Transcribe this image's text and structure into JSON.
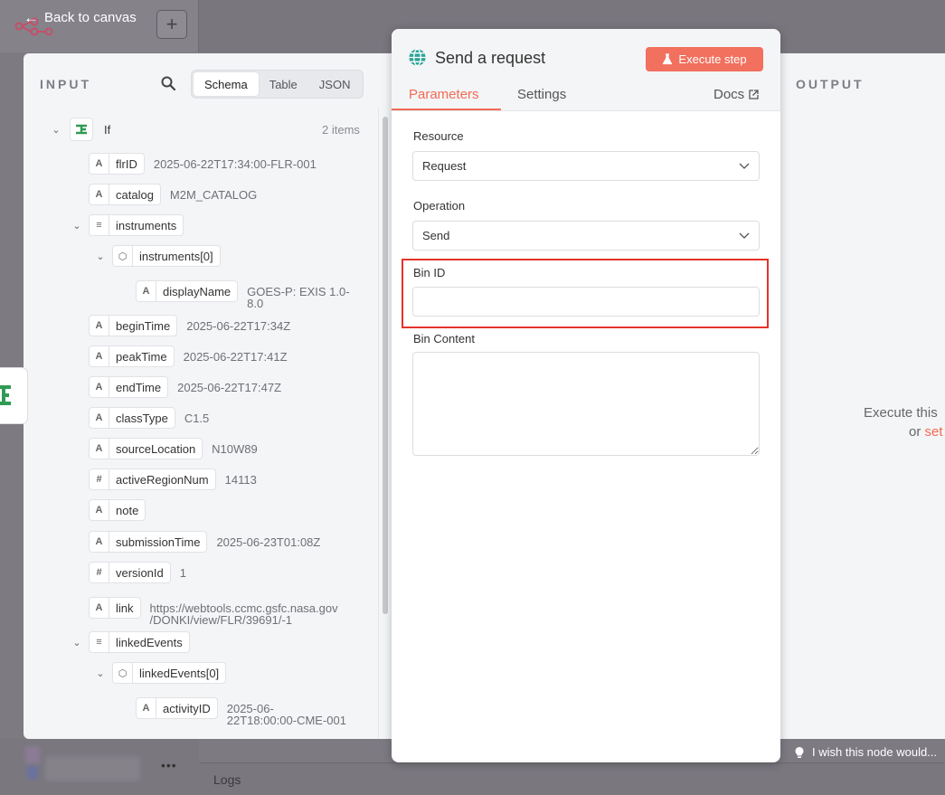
{
  "header": {
    "back_label": "Back to canvas",
    "logo_text": "n8n"
  },
  "input": {
    "title": "INPUT",
    "views": [
      "Schema",
      "Table",
      "JSON"
    ],
    "active_view": "Schema",
    "root": {
      "label": "If",
      "count": "2 items"
    },
    "fields": [
      {
        "type": "A",
        "key": "flrID",
        "value": "2025-06-22T17:34:00-FLR-001"
      },
      {
        "type": "A",
        "key": "catalog",
        "value": "M2M_CATALOG"
      },
      {
        "type": "list",
        "key": "instruments",
        "value": ""
      },
      {
        "type": "obj",
        "key": "instruments[0]",
        "value": ""
      },
      {
        "type": "A",
        "key": "displayName",
        "value": "GOES-P: EXIS 1.0-",
        "value2": "8.0"
      },
      {
        "type": "A",
        "key": "beginTime",
        "value": "2025-06-22T17:34Z"
      },
      {
        "type": "A",
        "key": "peakTime",
        "value": "2025-06-22T17:41Z"
      },
      {
        "type": "A",
        "key": "endTime",
        "value": "2025-06-22T17:47Z"
      },
      {
        "type": "A",
        "key": "classType",
        "value": "C1.5"
      },
      {
        "type": "A",
        "key": "sourceLocation",
        "value": "N10W89"
      },
      {
        "type": "#",
        "key": "activeRegionNum",
        "value": "14113"
      },
      {
        "type": "A",
        "key": "note",
        "value": ""
      },
      {
        "type": "A",
        "key": "submissionTime",
        "value": "2025-06-23T01:08Z"
      },
      {
        "type": "#",
        "key": "versionId",
        "value": "1"
      },
      {
        "type": "A",
        "key": "link",
        "value": "https://webtools.ccmc.gsfc.nasa.gov",
        "value2": "/DONKI/view/FLR/39691/-1"
      },
      {
        "type": "list",
        "key": "linkedEvents",
        "value": ""
      },
      {
        "type": "obj",
        "key": "linkedEvents[0]",
        "value": ""
      },
      {
        "type": "A",
        "key": "activityID",
        "value": "2025-06-",
        "value2": "22T18:00:00-CME-001"
      }
    ]
  },
  "node": {
    "title": "Send a request",
    "execute_label": "Execute step",
    "tabs": [
      "Parameters",
      "Settings"
    ],
    "docs_label": "Docs",
    "resource": {
      "label": "Resource",
      "value": "Request"
    },
    "operation": {
      "label": "Operation",
      "value": "Send"
    },
    "bin_id": {
      "label": "Bin ID",
      "value": ""
    },
    "bin_content": {
      "label": "Bin Content",
      "value": ""
    }
  },
  "output": {
    "title": "OUTPUT",
    "hint_line1": "Execute this",
    "hint_line2_prefix": "or ",
    "hint_line2_link": "set"
  },
  "footer": {
    "logs_label": "Logs",
    "wish_label": "I wish this node would..."
  },
  "colors": {
    "accent": "#f26a54",
    "execute_button": "#f2705e",
    "highlight": "#e5332a",
    "if_icon": "#2f9b54",
    "globe_icon": "#2fa39a"
  }
}
